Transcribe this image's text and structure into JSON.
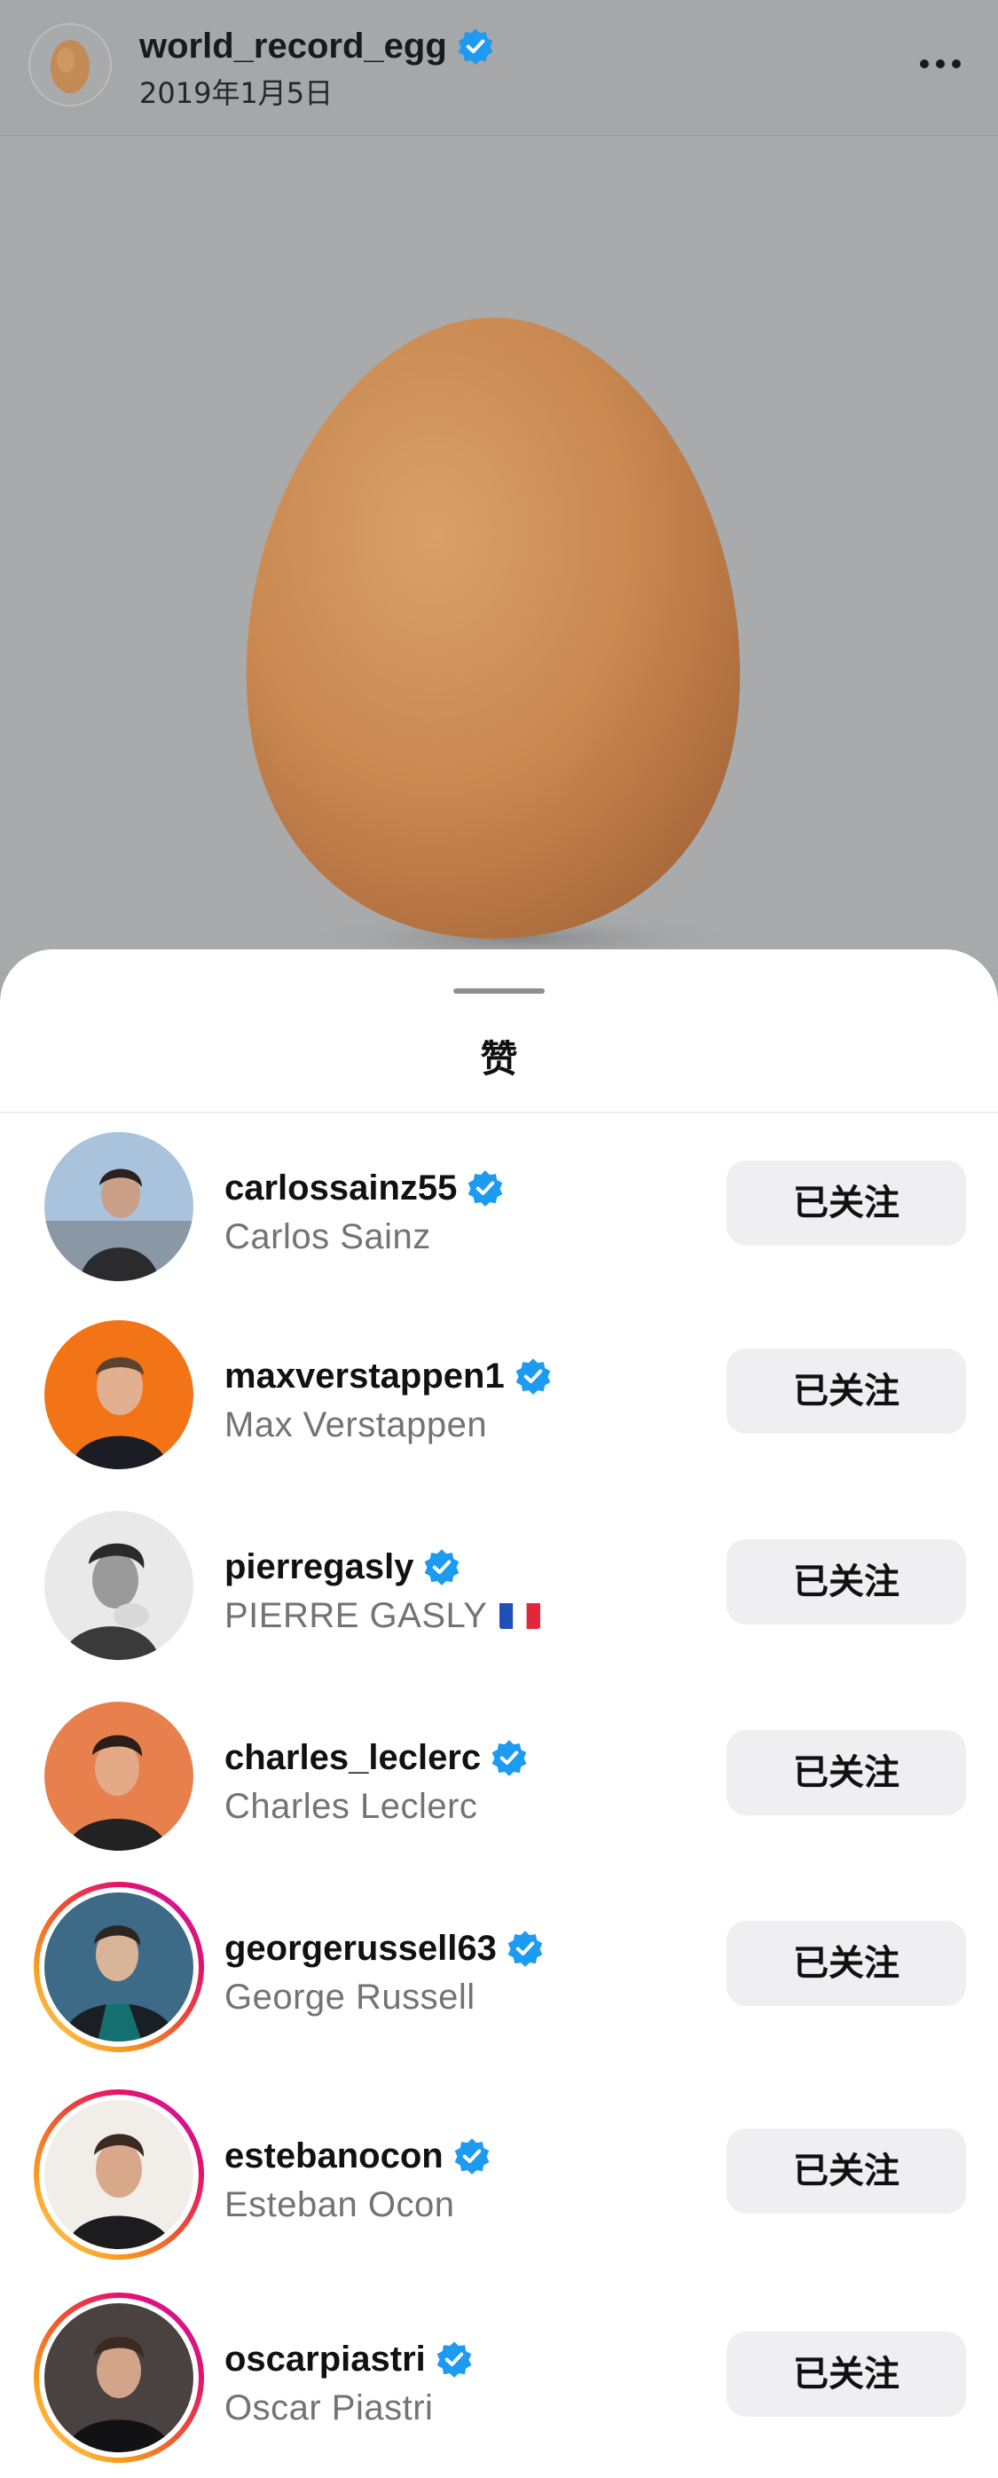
{
  "post": {
    "username": "world_record_egg",
    "date": "2019年1月5日",
    "verified": true,
    "more_icon": "more-horizontal-icon",
    "photo_description_icon": "egg-photo"
  },
  "sheet": {
    "title": "赞"
  },
  "colors": {
    "verified_blue": "#1d9bf0",
    "button_bg": "#efeff1",
    "secondary_text": "#737373"
  },
  "likes": [
    {
      "username": "carlossainz55",
      "full_name": "Carlos Sainz",
      "verified": true,
      "button": "已关注",
      "story_ring": false
    },
    {
      "username": "maxverstappen1",
      "full_name": "Max Verstappen",
      "verified": true,
      "button": "已关注",
      "story_ring": false
    },
    {
      "username": "pierregasly",
      "full_name": "PIERRE GASLY",
      "flag": "🇫🇷",
      "verified": true,
      "button": "已关注",
      "story_ring": false
    },
    {
      "username": "charles_leclerc",
      "full_name": "Charles Leclerc",
      "verified": true,
      "button": "已关注",
      "story_ring": false
    },
    {
      "username": "georgerussell63",
      "full_name": "George Russell",
      "verified": true,
      "button": "已关注",
      "story_ring": true
    },
    {
      "username": "estebanocon",
      "full_name": "Esteban Ocon",
      "verified": true,
      "button": "已关注",
      "story_ring": true
    },
    {
      "username": "oscarpiastri",
      "full_name": "Oscar Piastri",
      "verified": true,
      "button": "已关注",
      "story_ring": true
    }
  ]
}
